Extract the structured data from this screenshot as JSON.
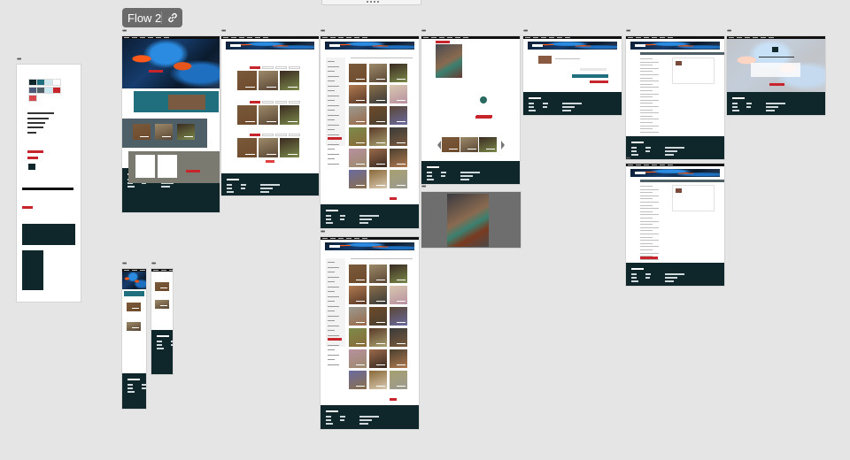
{
  "canvas": {
    "background": "#e5e5e5",
    "flow": {
      "label": "Flow 2",
      "icon": "link-icon"
    },
    "frame_menu_glyph": "•••"
  },
  "colors": {
    "footer": "#0f262b",
    "accent_red": "#c8242c",
    "teal": "#1f6f7e",
    "slate": "#4f5f68",
    "olive_gray": "#7a7a70",
    "swatches": [
      "#0f262b",
      "#1f6f7e",
      "#cfe8ee",
      "#ffffff",
      "#4a5a78",
      "#4f5f68",
      "#c9e9f2",
      "#c8242c",
      "#d9484e"
    ]
  }
}
